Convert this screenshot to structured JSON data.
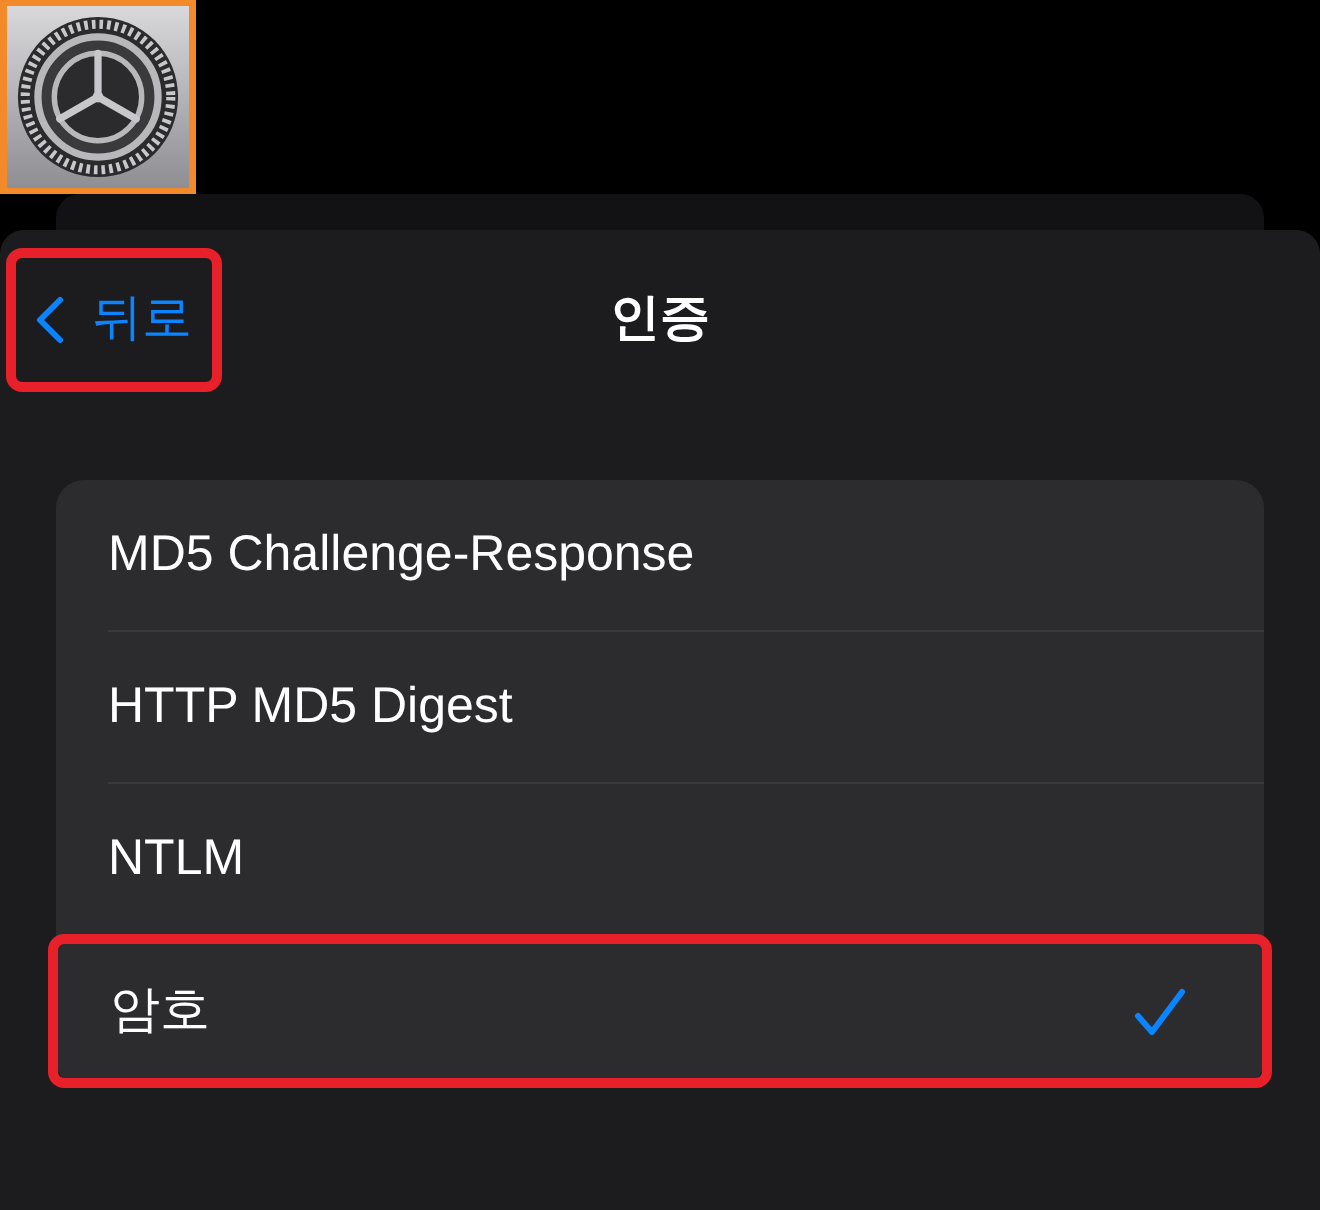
{
  "app_icon": {
    "highlighted": true
  },
  "nav": {
    "back": {
      "label": "뒤로",
      "highlighted": true
    },
    "title": "인증"
  },
  "options": [
    {
      "label": "MD5 Challenge-Response",
      "selected": false,
      "highlighted": false
    },
    {
      "label": "HTTP MD5 Digest",
      "selected": false,
      "highlighted": false
    },
    {
      "label": "NTLM",
      "selected": false,
      "highlighted": false
    },
    {
      "label": "암호",
      "selected": true,
      "highlighted": true
    }
  ]
}
